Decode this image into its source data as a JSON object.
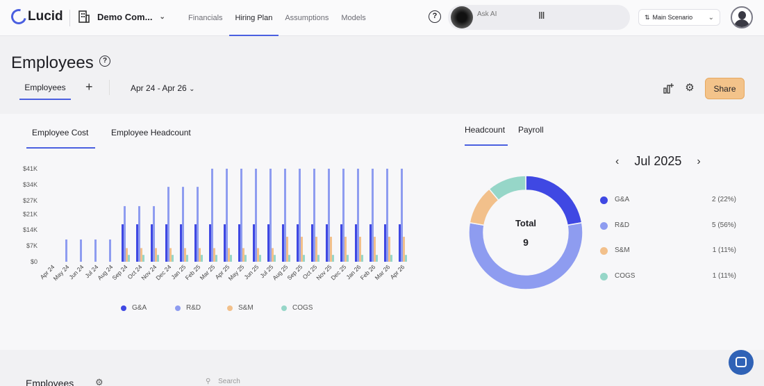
{
  "nav": {
    "logo": "Lucid",
    "company": "Demo Com...",
    "tabs": [
      {
        "label": "Financials",
        "active": false
      },
      {
        "label": "Hiring Plan",
        "active": true
      },
      {
        "label": "Assumptions",
        "active": false
      },
      {
        "label": "Models",
        "active": false
      }
    ],
    "ask_placeholder": "Ask AI",
    "scenario": "Main Scenario"
  },
  "header": {
    "title": "Employees",
    "subtab": "Employees",
    "add": "+",
    "range": "Apr 24 - Apr 26",
    "share": "Share"
  },
  "left_tabs": [
    "Employee Cost",
    "Employee Headcount"
  ],
  "right_tabs": [
    "Headcount",
    "Payroll"
  ],
  "colors": {
    "ga": "#3f48e3",
    "rd": "#8e9cf0",
    "sm": "#f2c08b",
    "cogs": "#96d6c8",
    "accent": "#4a5fe0"
  },
  "chart_data": [
    {
      "type": "bar",
      "title": "",
      "xlabel": "",
      "ylabel": "",
      "ylim": [
        0,
        41000
      ],
      "yticks": [
        "$0",
        "$7K",
        "$14K",
        "$21K",
        "$27K",
        "$34K",
        "$41K"
      ],
      "ytick_values": [
        0,
        7000,
        14000,
        21000,
        27000,
        34000,
        41000
      ],
      "categories": [
        "Apr 24",
        "May 24",
        "Jun 24",
        "Jul 24",
        "Aug 24",
        "Sep 24",
        "Oct 24",
        "Nov 24",
        "Dec 24",
        "Jan 25",
        "Feb 25",
        "Mar 25",
        "Apr 25",
        "May 25",
        "Jun 25",
        "Jul 25",
        "Aug 25",
        "Sep 25",
        "Oct 25",
        "Nov 25",
        "Dec 25",
        "Jan 26",
        "Feb 26",
        "Mar 26",
        "Apr 26"
      ],
      "grid": false,
      "legend": "bottom",
      "series": [
        {
          "name": "G&A",
          "color": "#3f48e3",
          "values": [
            0,
            0,
            0,
            0,
            0,
            16500,
            16500,
            16500,
            16500,
            16500,
            16500,
            16500,
            16500,
            16500,
            16500,
            16500,
            16500,
            16500,
            16500,
            16500,
            16500,
            16500,
            16500,
            16500,
            16500
          ]
        },
        {
          "name": "R&D",
          "color": "#8e9cf0",
          "values": [
            0,
            9800,
            9800,
            9800,
            9800,
            24500,
            24500,
            24500,
            33000,
            33000,
            33000,
            41000,
            41000,
            41000,
            41000,
            41000,
            41000,
            41000,
            41000,
            41000,
            41000,
            41000,
            41000,
            41000,
            41000
          ]
        },
        {
          "name": "S&M",
          "color": "#f2c08b",
          "values": [
            0,
            0,
            0,
            0,
            0,
            6000,
            6000,
            6000,
            6000,
            6000,
            6000,
            6000,
            6000,
            6000,
            6000,
            6000,
            11000,
            11000,
            11000,
            11000,
            11000,
            11000,
            11000,
            11000,
            11000
          ]
        },
        {
          "name": "COGS",
          "color": "#96d6c8",
          "values": [
            0,
            0,
            0,
            0,
            0,
            3000,
            3000,
            3000,
            3000,
            3000,
            3000,
            3000,
            3000,
            3000,
            3000,
            3000,
            3000,
            3000,
            3000,
            3000,
            3000,
            3000,
            3000,
            3000,
            3000
          ]
        }
      ]
    },
    {
      "type": "pie",
      "title": "Jul 2025",
      "center_label": "Total",
      "center_value": "9",
      "slices": [
        {
          "name": "G&A",
          "value": 2,
          "label": "2 (22%)",
          "color": "#3f48e3"
        },
        {
          "name": "R&D",
          "value": 5,
          "label": "5 (56%)",
          "color": "#8e9cf0"
        },
        {
          "name": "S&M",
          "value": 1,
          "label": "1 (11%)",
          "color": "#f2c08b"
        },
        {
          "name": "COGS",
          "value": 1,
          "label": "1 (11%)",
          "color": "#96d6c8"
        }
      ]
    }
  ],
  "bottom": {
    "title": "Employees",
    "search": "Search"
  }
}
